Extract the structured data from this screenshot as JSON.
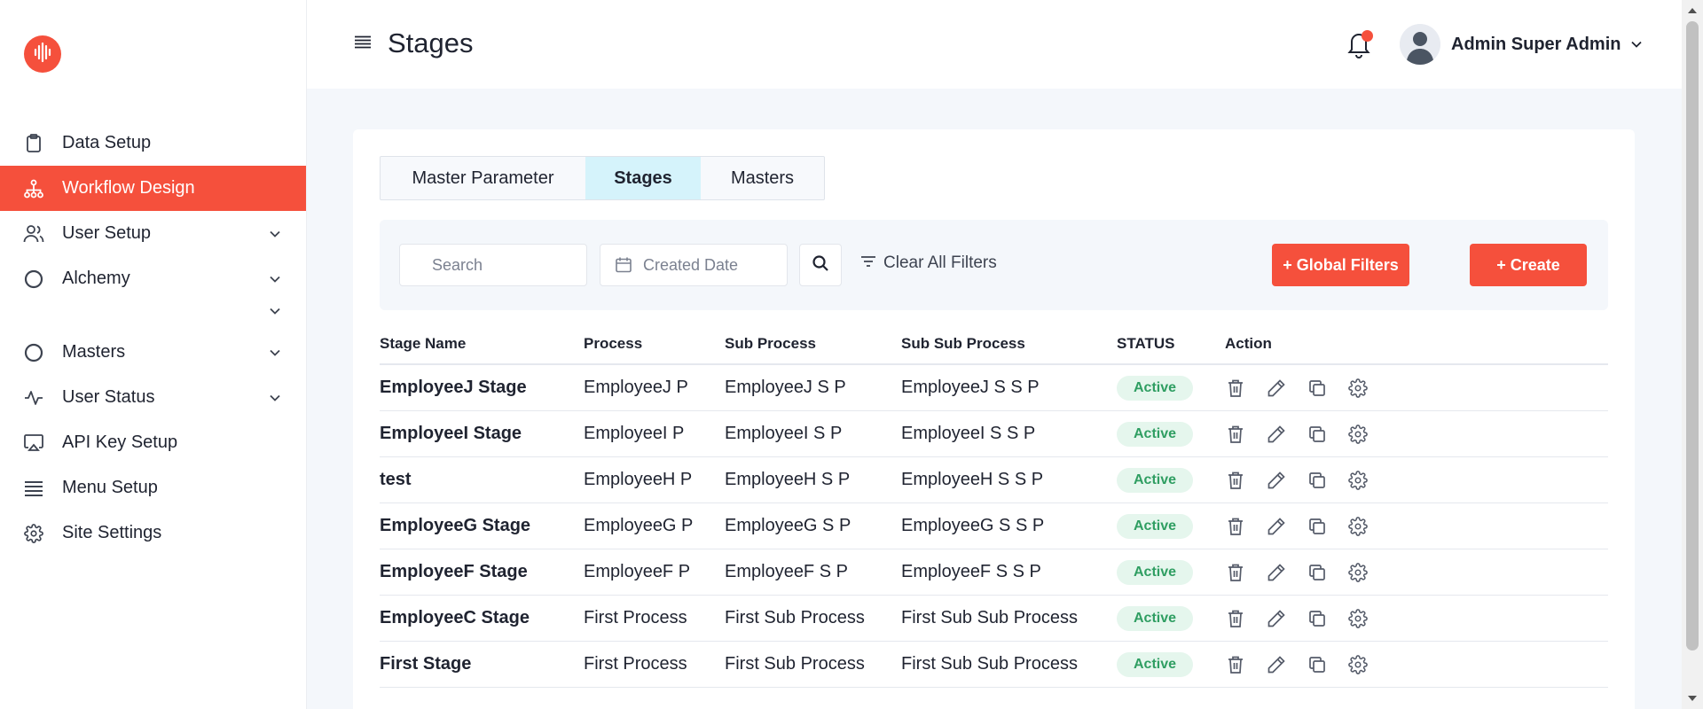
{
  "sidebar": {
    "logo_icon": "waveform-icon",
    "items": [
      {
        "label": "Data Setup",
        "icon": "clipboard-icon",
        "has_chevron": false,
        "active": false
      },
      {
        "label": "Workflow Design",
        "icon": "hierarchy-icon",
        "has_chevron": false,
        "active": true
      },
      {
        "label": "User Setup",
        "icon": "users-icon",
        "has_chevron": true,
        "active": false
      },
      {
        "label": "Alchemy",
        "icon": "circle-icon",
        "has_chevron": true,
        "active": false
      },
      {
        "label": "Masters",
        "icon": "circle-icon",
        "has_chevron": true,
        "active": false
      },
      {
        "label": "User Status",
        "icon": "activity-icon",
        "has_chevron": true,
        "active": false
      },
      {
        "label": "API Key Setup",
        "icon": "cast-icon",
        "has_chevron": false,
        "active": false
      },
      {
        "label": "Menu Setup",
        "icon": "list-icon",
        "has_chevron": false,
        "active": false
      },
      {
        "label": "Site Settings",
        "icon": "gear-icon",
        "has_chevron": false,
        "active": false
      }
    ]
  },
  "header": {
    "title": "Stages",
    "user_name": "Admin Super Admin"
  },
  "tabs": [
    {
      "label": "Master Parameter",
      "active": false
    },
    {
      "label": "Stages",
      "active": true
    },
    {
      "label": "Masters",
      "active": false
    }
  ],
  "filters": {
    "search_placeholder": "Search",
    "date_placeholder": "Created Date",
    "clear_label": "Clear All Filters",
    "global_filters_label": "+ Global Filters",
    "create_label": "+ Create"
  },
  "table": {
    "columns": [
      "Stage Name",
      "Process",
      "Sub Process",
      "Sub Sub Process",
      "STATUS",
      "Action"
    ],
    "rows": [
      {
        "stage": "EmployeeJ Stage",
        "process": "EmployeeJ P",
        "sub": "EmployeeJ S P",
        "subsub": "EmployeeJ S S P",
        "status": "Active"
      },
      {
        "stage": "EmployeeI Stage",
        "process": "EmployeeI P",
        "sub": "EmployeeI S P",
        "subsub": "EmployeeI S S P",
        "status": "Active"
      },
      {
        "stage": "test",
        "process": "EmployeeH P",
        "sub": "EmployeeH S P",
        "subsub": "EmployeeH S S P",
        "status": "Active"
      },
      {
        "stage": "EmployeeG Stage",
        "process": "EmployeeG P",
        "sub": "EmployeeG S P",
        "subsub": "EmployeeG S S P",
        "status": "Active"
      },
      {
        "stage": "EmployeeF Stage",
        "process": "EmployeeF P",
        "sub": "EmployeeF S P",
        "subsub": "EmployeeF S S P",
        "status": "Active"
      },
      {
        "stage": "EmployeeC Stage",
        "process": "First Process",
        "sub": "First Sub Process",
        "subsub": "First Sub Sub Process",
        "status": "Active"
      },
      {
        "stage": "First Stage",
        "process": "First Process",
        "sub": "First Sub Process",
        "subsub": "First Sub Sub Process",
        "status": "Active"
      }
    ]
  },
  "colors": {
    "accent": "#f5503c",
    "active_tab": "#d5f3fb",
    "status_bg": "#e5f6ed",
    "status_text": "#2f9e62"
  }
}
